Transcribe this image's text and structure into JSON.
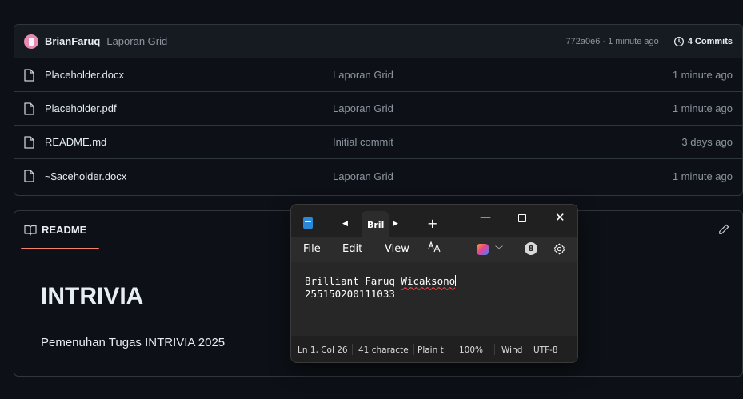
{
  "commit_bar": {
    "author": "BrianFaruq",
    "message": "Laporan Grid",
    "hash_time": "772a0e6 · 1 minute ago",
    "commits_label": "4 Commits"
  },
  "files": [
    {
      "name": "Placeholder.docx",
      "commit": "Laporan Grid",
      "time": "1 minute ago"
    },
    {
      "name": "Placeholder.pdf",
      "commit": "Laporan Grid",
      "time": "1 minute ago"
    },
    {
      "name": "README.md",
      "commit": "Initial commit",
      "time": "3 days ago"
    },
    {
      "name": "~$aceholder.docx",
      "commit": "Laporan Grid",
      "time": "1 minute ago"
    }
  ],
  "readme": {
    "tab_label": "README",
    "title": "INTRIVIA",
    "text": "Pemenuhan Tugas INTRIVIA 2025"
  },
  "notepad": {
    "tab_label": "Bril",
    "add_tab": "+",
    "menu": {
      "file": "File",
      "edit": "Edit",
      "view": "View"
    },
    "profile_initial": "8",
    "content": {
      "line1_prefix": "Brilliant Faruq ",
      "line1_misspelled": "Wicaksono",
      "line2": "255150200111033"
    },
    "status": {
      "position": "Ln 1, Col 26",
      "chars": "41 characte",
      "format": "Plain t",
      "zoom": "100%",
      "line_ending": "Wind",
      "encoding": "UTF-8"
    }
  },
  "colors": {
    "page_bg": "#0d1117",
    "border": "#30363d",
    "muted_text": "#8d96a0",
    "tab_underline": "#f78166",
    "notepad_bg": "#202020"
  }
}
